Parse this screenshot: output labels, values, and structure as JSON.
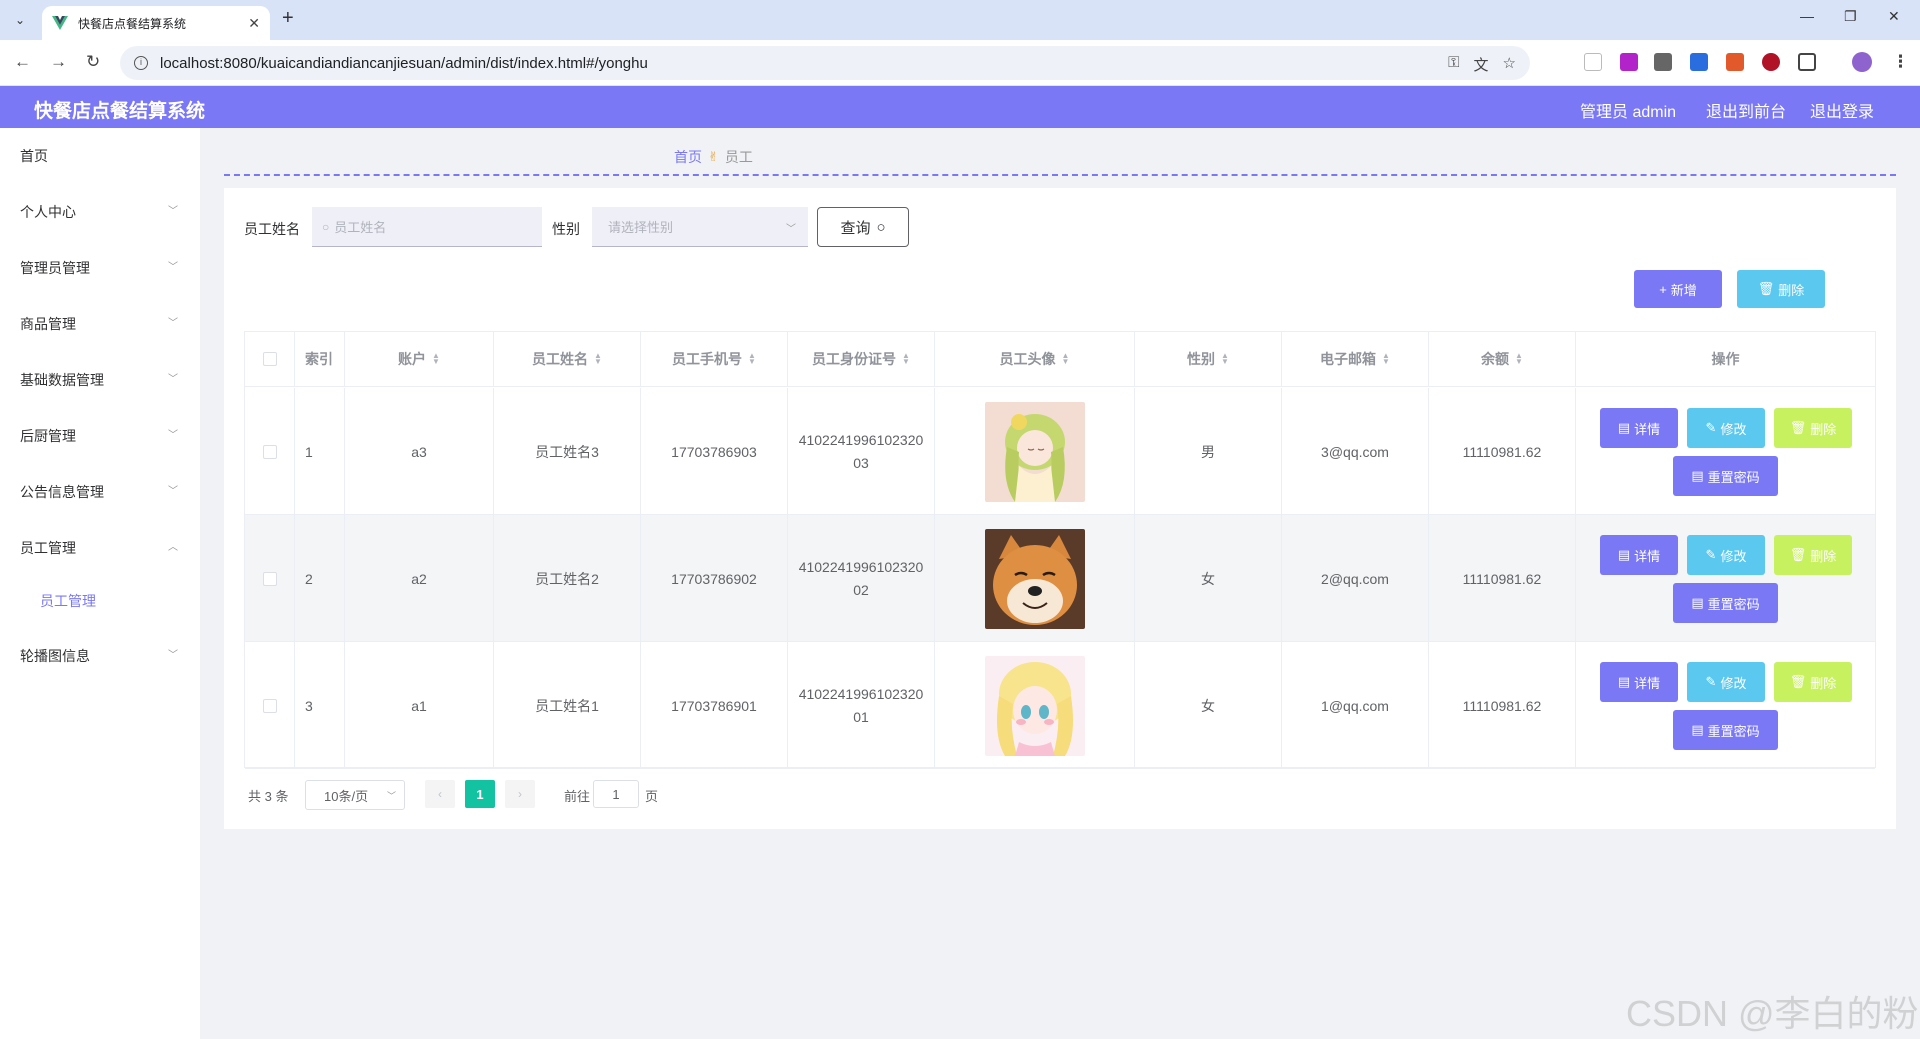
{
  "browser": {
    "tab_title": "快餐店点餐结算系统",
    "url": "localhost:8080/kuaicandiandiancanjiesuan/admin/dist/index.html#/yonghu"
  },
  "header": {
    "title": "快餐店点餐结算系统",
    "admin_label": "管理员 admin",
    "to_front_label": "退出到前台",
    "logout_label": "退出登录"
  },
  "sidebar": {
    "items": [
      {
        "label": "首页",
        "expandable": false
      },
      {
        "label": "个人中心",
        "expandable": true
      },
      {
        "label": "管理员管理",
        "expandable": true
      },
      {
        "label": "商品管理",
        "expandable": true
      },
      {
        "label": "基础数据管理",
        "expandable": true
      },
      {
        "label": "后厨管理",
        "expandable": true
      },
      {
        "label": "公告信息管理",
        "expandable": true
      },
      {
        "label": "员工管理",
        "expandable": true,
        "open": true
      },
      {
        "label": "轮播图信息",
        "expandable": true
      }
    ],
    "submenu_active": "员工管理"
  },
  "breadcrumb": {
    "home": "首页",
    "current": "员工"
  },
  "search": {
    "name_label": "员工姓名",
    "name_placeholder": "员工姓名",
    "gender_label": "性别",
    "gender_placeholder": "请选择性别",
    "query_label": "查询"
  },
  "actions": {
    "add_label": "新增",
    "delete_label": "删除"
  },
  "table": {
    "headers": {
      "index": "索引",
      "account": "账户",
      "name": "员工姓名",
      "phone": "员工手机号",
      "id_card": "员工身份证号",
      "avatar": "员工头像",
      "gender": "性别",
      "email": "电子邮箱",
      "balance": "余额",
      "ops": "操作"
    },
    "rows": [
      {
        "index": "1",
        "account": "a3",
        "name": "员工姓名3",
        "phone": "17703786903",
        "id_card": "410224199610232003",
        "gender": "男",
        "email": "3@qq.com",
        "balance": "11110981.62",
        "avatar": "anime-girl-green-hair"
      },
      {
        "index": "2",
        "account": "a2",
        "name": "员工姓名2",
        "phone": "17703786902",
        "id_card": "410224199610232002",
        "gender": "女",
        "email": "2@qq.com",
        "balance": "11110981.62",
        "avatar": "shiba-dog"
      },
      {
        "index": "3",
        "account": "a1",
        "name": "员工姓名1",
        "phone": "17703786901",
        "id_card": "410224199610232001",
        "gender": "女",
        "email": "1@qq.com",
        "balance": "11110981.62",
        "avatar": "anime-girl-blonde"
      }
    ],
    "op_labels": {
      "detail": "详情",
      "edit": "修改",
      "delete": "删除",
      "reset": "重置密码"
    }
  },
  "pagination": {
    "total": "共 3 条",
    "page_size": "10条/页",
    "current_page": "1",
    "goto_label": "前往",
    "goto_value": "1",
    "page_unit": "页"
  },
  "watermark": "CSDN @李白的粉",
  "colors": {
    "accent": "#7a78f5",
    "info": "#5bc8ef",
    "lime": "#c8f15f",
    "page_active": "#13c2a0"
  }
}
